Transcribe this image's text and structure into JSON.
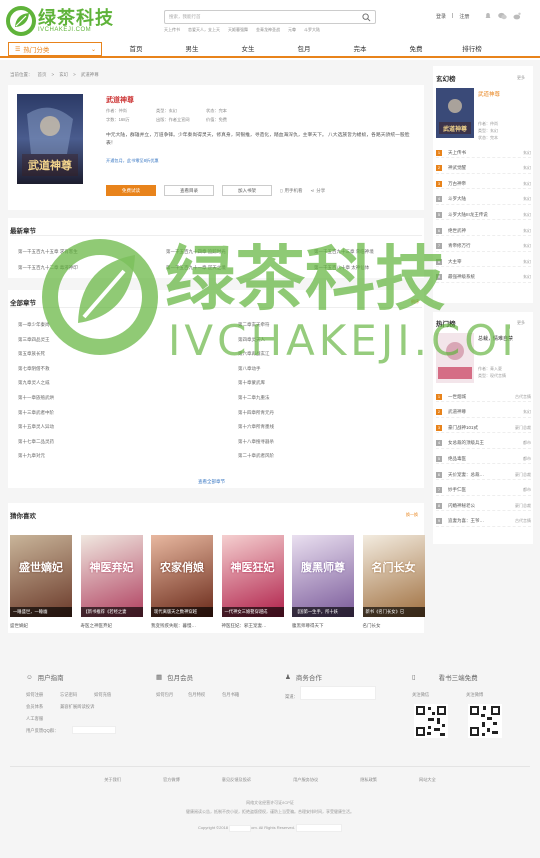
{
  "header": {
    "logo_text": "绿茶科技",
    "logo_sub": "IVCHAKEJI.COM",
    "search_placeholder": "搜索，我能行首",
    "hot_words": [
      "天上传书",
      "恋爱天人，支上天",
      "天姬暮强舞",
      "金青龙神圣战",
      "元尊",
      "斗罗大陆"
    ],
    "login": "登录",
    "register": "注册",
    "sep": "|"
  },
  "nav": {
    "drop_label": "热门分类",
    "items": [
      "首页",
      "男生",
      "女生",
      "包月",
      "完本",
      "免费",
      "排行榜"
    ]
  },
  "breadcrumb": [
    "当前位置：",
    "首页",
    ">",
    "玄幻",
    ">",
    "武道神尊"
  ],
  "book": {
    "title": "武道神尊",
    "meta": [
      "作者：仲尚",
      "类型：玄幻",
      "状态：完本",
      "字数：168万",
      "出版：作者立宣网",
      "价值：免费"
    ],
    "desc": "中元大陆，群雄并立，万道争锋。少年秦尚得灵天，修真身，同银推，寻造化，踏血海深仇，主宰天下。 八大选族皆为蝼蚁，各路天骄统一股脸表！",
    "vip": "开通包月，此书零至8折优惠",
    "btn_read": "免费试读",
    "btn_catalog": "查看目录",
    "btn_shelf": "加入书架",
    "phone": "用手机看",
    "share": "分享",
    "cover_title": "武道神尊"
  },
  "latest": {
    "title": "最新章节",
    "chapters": [
      "第一千五百九十五章 求有客生",
      "第一千五百九十四章 追踪时光",
      "第一千五百九十三章 荣临神境",
      "第一千五百九十二章 毒液神印",
      "第一千五百九十一章 逆天之境",
      "第一千五百八十章 太神仙体"
    ]
  },
  "all": {
    "title": "全部章节",
    "more": "倒序",
    "chapters": [
      "第一章少年秦尚",
      "第二章玄天牵符",
      "第三章四品灵王",
      "第四章灵天人",
      "第五章族长死",
      "第六章再战玄江",
      "第七章阴僧不救",
      "第八章动手",
      "第九章灵人之威",
      "第十章蒙武库",
      "第十一章族殖武烘",
      "第十二章九重法",
      "第十三章武者中阶",
      "第十四章所青元丹",
      "第十五章灵人异动",
      "第十六章所青墨线",
      "第十七章二品灵药",
      "第十八章搜寻器杀",
      "第十九章对元",
      "第二十章武者风阶"
    ],
    "view_all": "查看全部章节"
  },
  "guess": {
    "title": "猜你喜欢",
    "more": "换一换",
    "books": [
      {
        "cap": "一睡盛世，一睡幽",
        "name": "盛世嫡妃",
        "cover": "盛世嫡妃"
      },
      {
        "cap": "【新书推荐《若经之妻",
        "name": "寿医之神医弃妃",
        "cover": "神医弃妃"
      },
      {
        "cap": "现代离版天之数神穿越",
        "name": "我变残疾失眠：暮慢…",
        "cover": "农家俏娘"
      },
      {
        "cap": "一代神女三娘娶穿越成",
        "name": "神医狂妃：邪王宠妻…",
        "cover": "神医狂妃"
      },
      {
        "cap": "【国第一生手，所十妖",
        "name": "腹黑师尊得天下",
        "cover": "腹黑师尊"
      },
      {
        "cap": "新书《名门长女》已",
        "name": "名门长女",
        "cover": "名门长女"
      }
    ]
  },
  "rank1": {
    "title": "玄幻榜",
    "more": "更多",
    "top_title": "武道神尊",
    "top_meta": [
      "作者：仲尚",
      "类型：玄幻",
      "状态：完本"
    ],
    "rows": [
      {
        "n": "1",
        "name": "天上传书",
        "tag": "玄幻"
      },
      {
        "n": "2",
        "name": "神武觉醒",
        "tag": "玄幻"
      },
      {
        "n": "3",
        "name": "万古神帝",
        "tag": "玄幻"
      },
      {
        "n": "4",
        "name": "斗罗大陆",
        "tag": "玄幻"
      },
      {
        "n": "5",
        "name": "斗罗大陆III龙王传说",
        "tag": "玄幻"
      },
      {
        "n": "6",
        "name": "绝世武神",
        "tag": "玄幻"
      },
      {
        "n": "7",
        "name": "青帝修万行",
        "tag": "玄幻"
      },
      {
        "n": "8",
        "name": "大主宰",
        "tag": "玄幻"
      },
      {
        "n": "9",
        "name": "最强神级系统",
        "tag": "玄幻"
      }
    ]
  },
  "rank2": {
    "title": "热门榜",
    "more": "更多",
    "top_title": "总裁，情难自禁",
    "top_meta": [
      "作者：青入夏",
      "类型：现代言情"
    ],
    "rows": [
      {
        "n": "1",
        "name": "一世烟城",
        "tag": "古代言情"
      },
      {
        "n": "2",
        "name": "武道神尊",
        "tag": "玄幻"
      },
      {
        "n": "3",
        "name": "豪门战神101式",
        "tag": "豪门总裁"
      },
      {
        "n": "4",
        "name": "女总裁的顶级兵王",
        "tag": "都市"
      },
      {
        "n": "5",
        "name": "绝品毒医",
        "tag": "都市"
      },
      {
        "n": "6",
        "name": "天价宠妻：总裁…",
        "tag": "豪门总裁"
      },
      {
        "n": "7",
        "name": "妙手仁医",
        "tag": "都市"
      },
      {
        "n": "8",
        "name": "闪婚神秘老公",
        "tag": "豪门总裁"
      },
      {
        "n": "9",
        "name": "追妻为喜：王爷…",
        "tag": "古代言情"
      }
    ]
  },
  "footer": {
    "guide_title": "用户指南",
    "guide_links": [
      "如何注册",
      "忘记密码",
      "如何充值",
      "会员体系",
      "兼容扩展阅读投诉",
      "人工客服",
      "用户反馈QQ群："
    ],
    "month_title": "包月会员",
    "month_links": [
      "如何包月",
      "包月特权",
      "包月书籍"
    ],
    "biz_title": "商务合作",
    "biz_phone": "渠道：",
    "app_title": "看书三端免费",
    "qr1": "关注微信",
    "qr2": "关注微博",
    "links": [
      "关于我们",
      "官方微博",
      "意见反馈及投诉",
      "用户服务协议",
      "隐私政策",
      "网站大全"
    ],
    "l1": "网络文化经营许可证/ICP证",
    "l2": "健康阅读公告，抵制不良小说，拒绝盗版侵权，谨防上当受骗。合理安排时间，享受健康生活。",
    "copy": "Copyright ©2018",
    "copy2": "om. All Rights Reserved."
  },
  "colors": {
    "accent": "#e8831b",
    "brand": "#5fb33a"
  },
  "watermark": {
    "text": "绿茶科技",
    "sub": "IVCHAKEJI.COM"
  }
}
